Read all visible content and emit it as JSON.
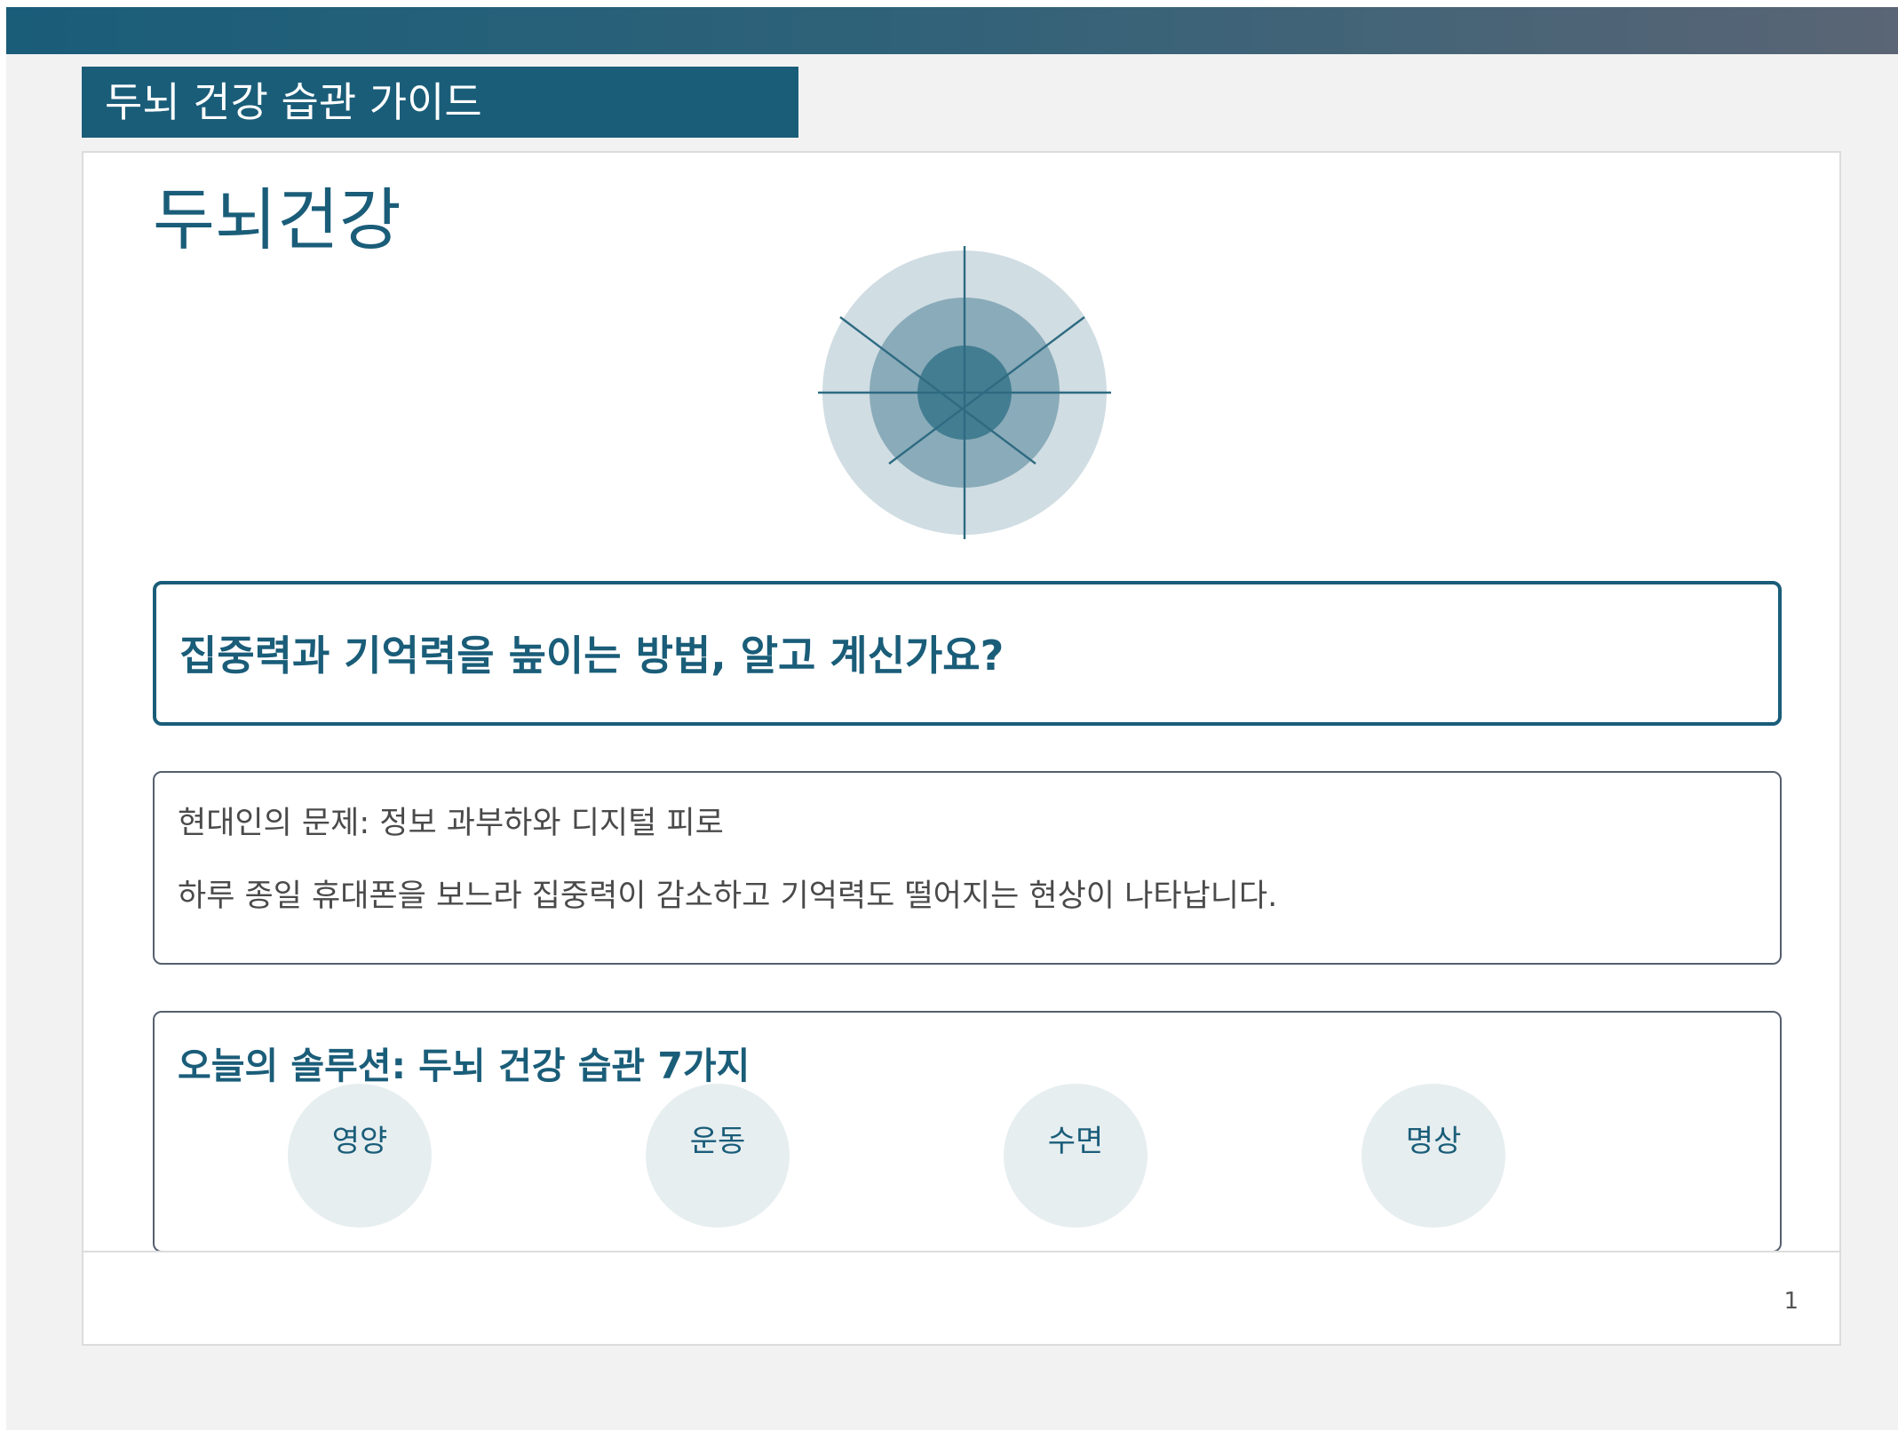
{
  "header": {
    "title": "두뇌 건강 습관 가이드"
  },
  "slide": {
    "heading": "두뇌건강",
    "question": "집중력과 기억력을 높이는 방법, 알고 계신가요?",
    "problem": {
      "title": "현대인의 문제: 정보 과부하와 디지털 피로",
      "body": "하루 종일 휴대폰을 보느라 집중력이 감소하고 기억력도 떨어지는 현상이 나타납니다."
    },
    "solution": {
      "title": "오늘의 솔루션: 두뇌 건강 습관 7가지",
      "habits": [
        "영양",
        "운동",
        "수면",
        "명상"
      ]
    },
    "page_number": "1"
  },
  "colors": {
    "primary": "#1a5d79",
    "ring_outer": "#d0dde3",
    "ring_middle": "#8aabb9",
    "ring_inner": "#437d92",
    "habit_circle": "#e7eef0"
  },
  "icons": {
    "brain_graphic": "concentric-target-icon"
  }
}
